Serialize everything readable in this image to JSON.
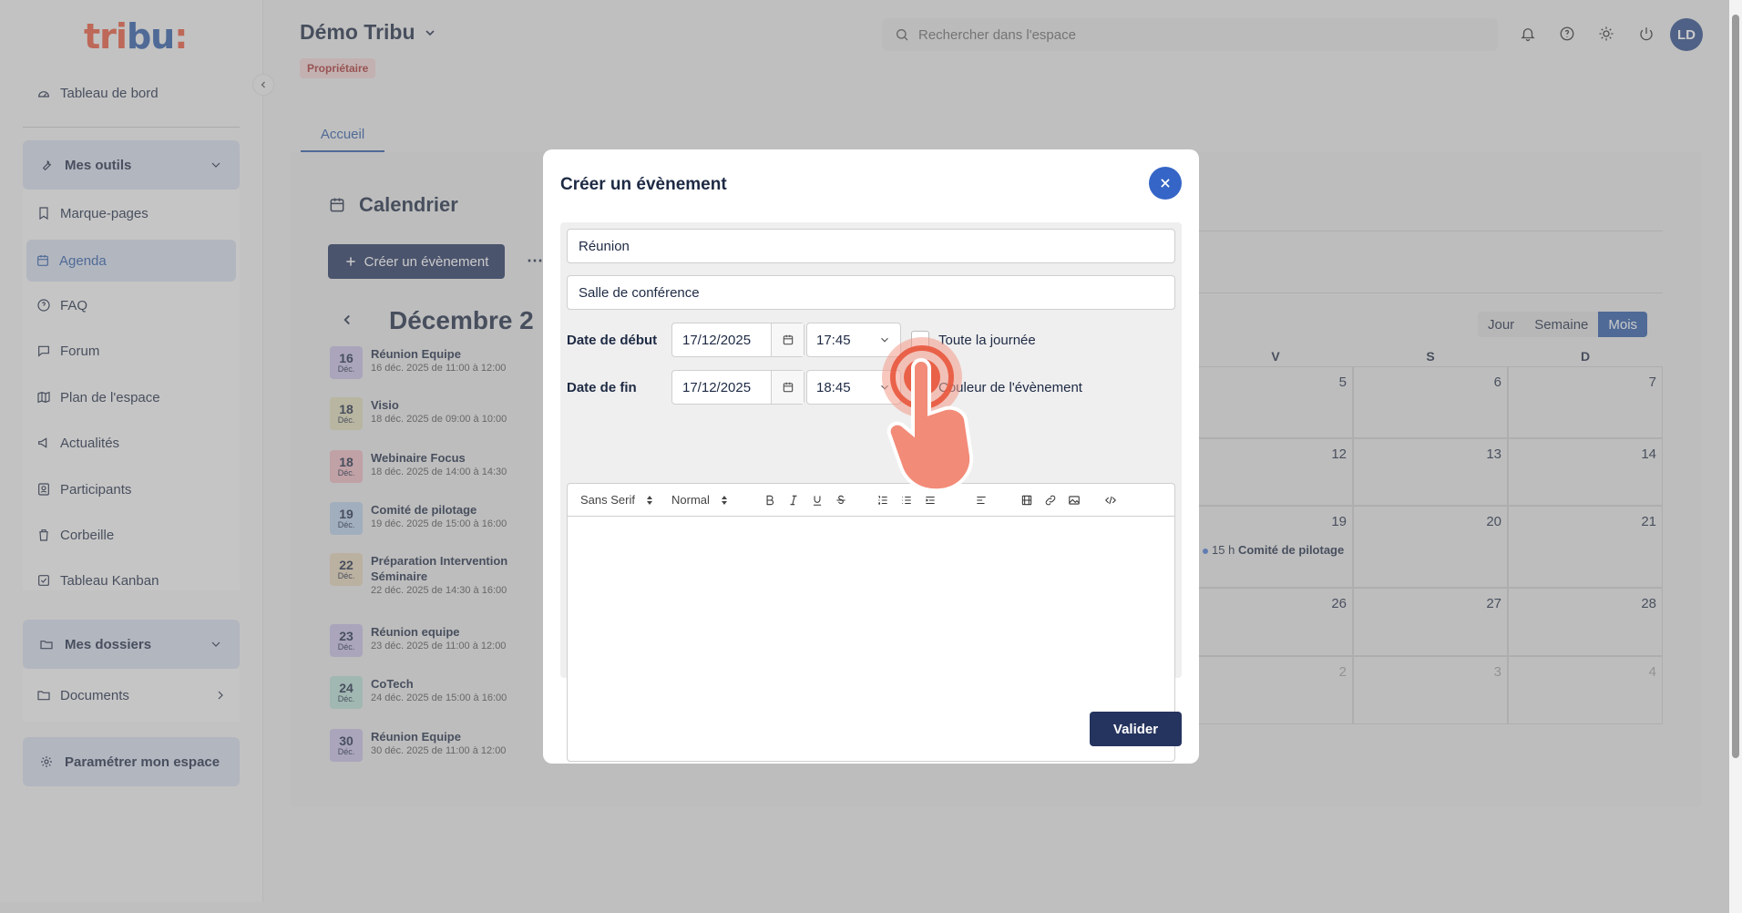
{
  "logo": "tribu:",
  "sidebar": {
    "dashboard": "Tableau de bord",
    "tools_title": "Mes outils",
    "tools": [
      {
        "label": "Marque-pages",
        "icon": "bookmark-icon"
      },
      {
        "label": "Agenda",
        "icon": "calendar-icon",
        "active": true
      },
      {
        "label": "FAQ",
        "icon": "help-circle-icon"
      },
      {
        "label": "Forum",
        "icon": "chat-icon"
      },
      {
        "label": "Plan de l'espace",
        "icon": "map-icon"
      },
      {
        "label": "Actualités",
        "icon": "megaphone-icon"
      },
      {
        "label": "Participants",
        "icon": "contact-icon"
      },
      {
        "label": "Corbeille",
        "icon": "trash-icon"
      },
      {
        "label": "Tableau Kanban",
        "icon": "kanban-icon"
      }
    ],
    "folders_title": "Mes dossiers",
    "documents": "Documents",
    "settings": "Paramétrer mon espace"
  },
  "header": {
    "space_name": "Démo Tribu",
    "role_badge": "Propriétaire",
    "search_placeholder": "Rechercher dans l'espace",
    "avatar_initials": "LD"
  },
  "tabs": {
    "home": "Accueil"
  },
  "calendar": {
    "title": "Calendrier",
    "create_button": "Créer un évènement",
    "more": "⋯",
    "month_label": "Décembre 2",
    "views": [
      "Jour",
      "Semaine",
      "Mois"
    ],
    "active_view": "Mois",
    "weekday_headers": [
      "V",
      "S",
      "D"
    ],
    "grid_rows": [
      [
        "5",
        "6",
        "7"
      ],
      [
        "12",
        "13",
        "14"
      ],
      [
        "19",
        "20",
        "21"
      ],
      [
        "26",
        "27",
        "28"
      ],
      [
        "2",
        "3",
        "4"
      ]
    ],
    "grid_event": {
      "time": "15 h",
      "name": "Comité de pilotage"
    },
    "events": [
      {
        "day": "16",
        "month": "Déc.",
        "name": "Réunion Equipe",
        "time": "16 déc. 2025 de 11:00 à 12:00",
        "color": "#c9c0e6"
      },
      {
        "day": "18",
        "month": "Déc.",
        "name": "Visio",
        "time": "18 déc. 2025 de 09:00 à 10:00",
        "color": "#e0dbb8"
      },
      {
        "day": "18",
        "month": "Déc.",
        "name": "Webinaire Focus",
        "time": "18 déc. 2025 de 14:00 à 14:30",
        "color": "#eeb8c2"
      },
      {
        "day": "19",
        "month": "Déc.",
        "name": "Comité de pilotage",
        "time": "19 déc. 2025 de 15:00 à 16:00",
        "color": "#b9cfe8"
      },
      {
        "day": "22",
        "month": "Déc.",
        "name": "Préparation Intervention Séminaire",
        "time": "22 déc. 2025 de 14:30 à 16:00",
        "color": "#e6d4b8"
      },
      {
        "day": "23",
        "month": "Déc.",
        "name": "Réunion equipe",
        "time": "23 déc. 2025 de 11:00 à 12:00",
        "color": "#c9c0e6"
      },
      {
        "day": "24",
        "month": "Déc.",
        "name": "CoTech",
        "time": "24 déc. 2025 de 15:00 à 16:00",
        "color": "#b9e0d6"
      },
      {
        "day": "30",
        "month": "Déc.",
        "name": "Réunion Equipe",
        "time": "30 déc. 2025 de 11:00 à 12:00",
        "color": "#c9c0e6"
      }
    ]
  },
  "modal": {
    "title": "Créer un évènement",
    "event_title_value": "Réunion",
    "location_value": "Salle de conférence",
    "start_label": "Date de début",
    "start_date": "17/12/2025",
    "start_time": "17:45",
    "all_day_label": "Toute la journée",
    "end_label": "Date de fin",
    "end_date": "17/12/2025",
    "end_time": "18:45",
    "color_label": "Couleur de l'évènement",
    "editor_font": "Sans Serif",
    "editor_size": "Normal",
    "submit": "Valider"
  },
  "colors": {
    "primary": "#25345f",
    "accent": "#3565c6",
    "brand_red": "#e8563c",
    "brand_blue": "#2c5aa6"
  }
}
